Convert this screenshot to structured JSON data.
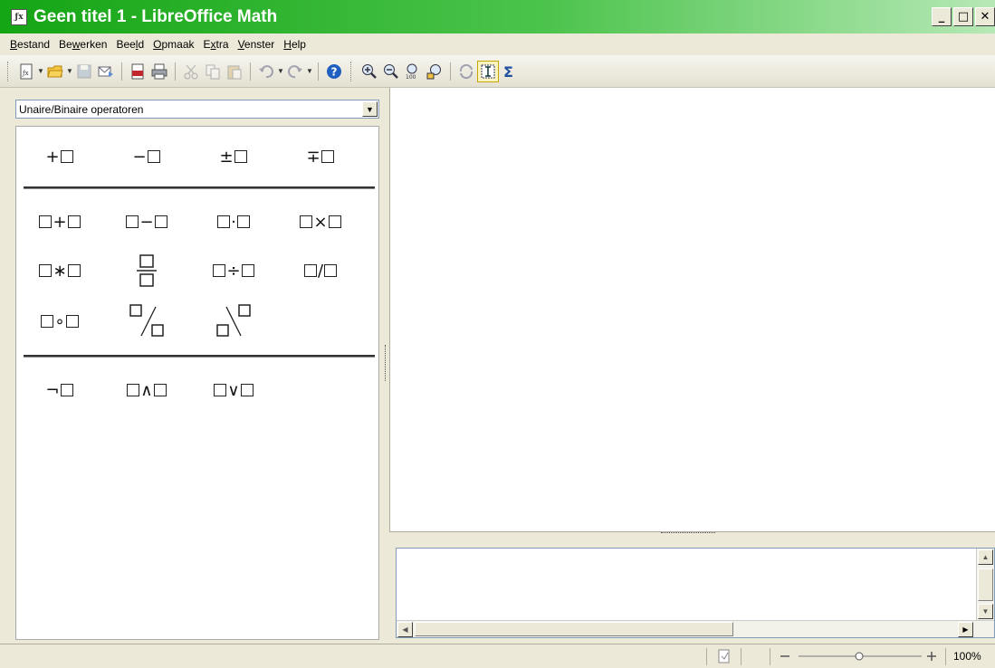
{
  "window": {
    "title": "Geen titel 1 - LibreOffice Math",
    "controls": [
      "minimize",
      "maximize",
      "close"
    ]
  },
  "menu": [
    {
      "label": "Bestand",
      "mnemonic": "B"
    },
    {
      "label": "Bewerken",
      "mnemonic": "w"
    },
    {
      "label": "Beeld",
      "mnemonic": "l"
    },
    {
      "label": "Opmaak",
      "mnemonic": "O"
    },
    {
      "label": "Extra",
      "mnemonic": "x"
    },
    {
      "label": "Venster",
      "mnemonic": "V"
    },
    {
      "label": "Help",
      "mnemonic": "H"
    }
  ],
  "toolbar": {
    "buttons": [
      "new-icon",
      "open-icon",
      "save-icon",
      "email-icon",
      "export-pdf-icon",
      "print-icon",
      "cut-icon",
      "copy-icon",
      "paste-icon",
      "undo-icon",
      "redo-icon",
      "help-icon",
      "zoom-in-icon",
      "zoom-out-icon",
      "zoom-100-icon",
      "show-all-icon",
      "update-icon",
      "formula-cursor-icon",
      "symbols-icon"
    ]
  },
  "elements_panel": {
    "category": "Unaire/Binaire operatoren",
    "unary": [
      "+□",
      "−□",
      "±□",
      "∓□"
    ],
    "binary_row1": [
      "□+□",
      "□−□",
      "□·□",
      "□×□"
    ],
    "binary_row2": [
      "□∗□",
      "□/□ (fraction)",
      "□÷□",
      "□/□"
    ],
    "binary_row3": [
      "□∘□",
      "wide slash",
      "wide backslash"
    ],
    "logic": [
      "¬□",
      "□∧□",
      "□∨□"
    ]
  },
  "command_window": {
    "text": ""
  },
  "status": {
    "zoom": "100%",
    "zoom_level": 100
  },
  "colors": {
    "titlebar_start": "#14a514",
    "titlebar_end": "#b6e8b6",
    "chrome": "#ece9d8"
  }
}
